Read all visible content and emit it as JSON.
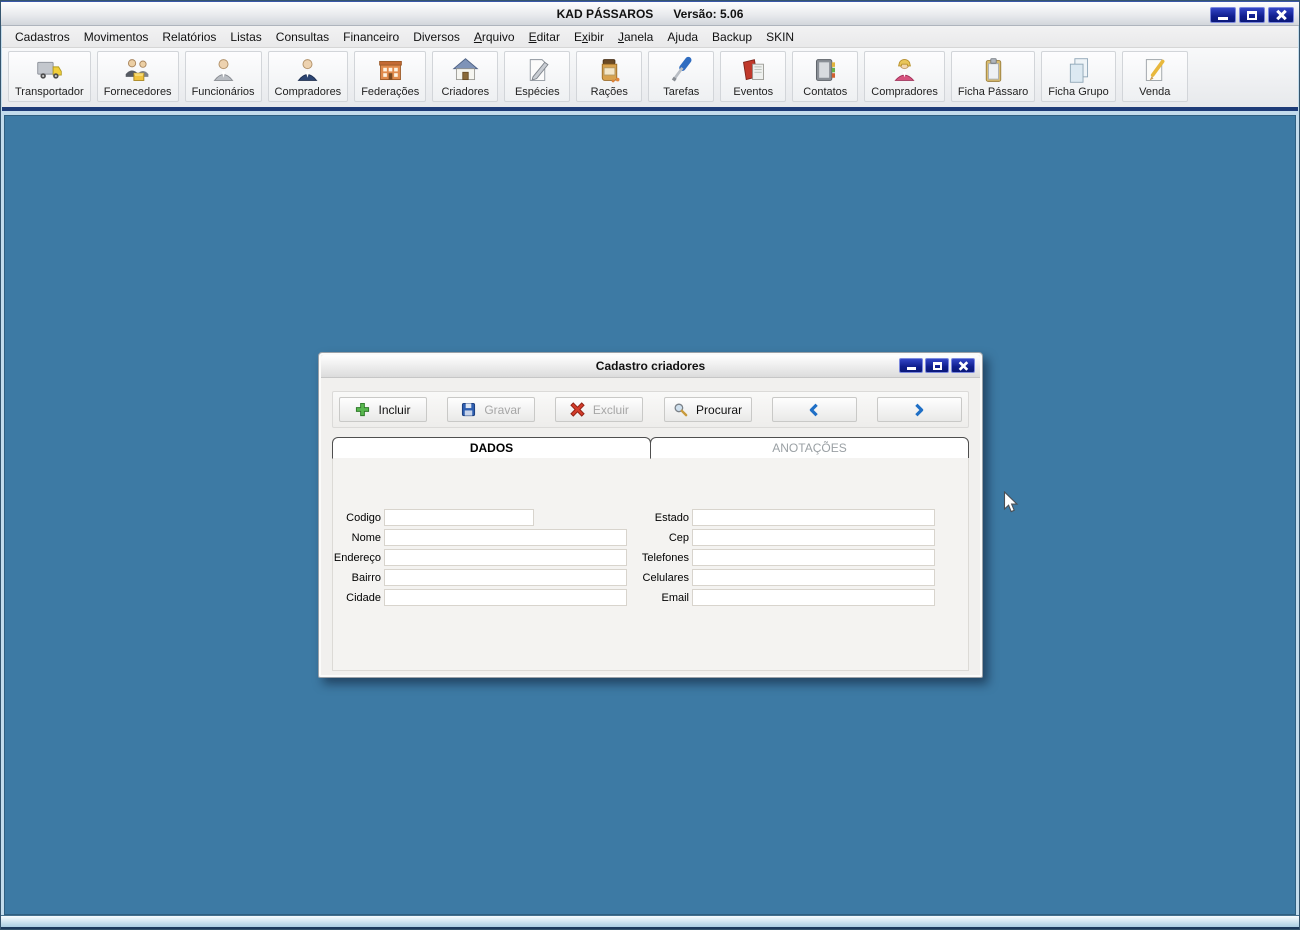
{
  "window": {
    "title": "KAD PÁSSAROS",
    "version_label": "Versão: 5.06"
  },
  "menubar": {
    "items": [
      {
        "label": "Cadastros",
        "underline": -1
      },
      {
        "label": "Movimentos",
        "underline": -1
      },
      {
        "label": "Relatórios",
        "underline": -1
      },
      {
        "label": "Listas",
        "underline": -1
      },
      {
        "label": "Consultas",
        "underline": -1
      },
      {
        "label": "Financeiro",
        "underline": -1
      },
      {
        "label": "Diversos",
        "underline": -1
      },
      {
        "label": "Arquivo",
        "underline": 0
      },
      {
        "label": "Editar",
        "underline": 0
      },
      {
        "label": "Exibir",
        "underline": 1
      },
      {
        "label": "Janela",
        "underline": 0
      },
      {
        "label": "Ajuda",
        "underline": -1
      },
      {
        "label": "Backup",
        "underline": -1
      },
      {
        "label": "SKIN",
        "underline": -1
      }
    ]
  },
  "toolbar": {
    "items": [
      {
        "label": "Transportador",
        "icon": "truck-icon"
      },
      {
        "label": "Fornecedores",
        "icon": "suppliers-icon"
      },
      {
        "label": "Funcionários",
        "icon": "employee-icon"
      },
      {
        "label": "Compradores",
        "icon": "buyer-icon"
      },
      {
        "label": "Federações",
        "icon": "federation-building-icon"
      },
      {
        "label": "Criadores",
        "icon": "house-icon"
      },
      {
        "label": "Espécies",
        "icon": "paper-pencil-icon"
      },
      {
        "label": "Rações",
        "icon": "feed-jar-icon"
      },
      {
        "label": "Tarefas",
        "icon": "screwdriver-icon"
      },
      {
        "label": "Eventos",
        "icon": "red-book-icon"
      },
      {
        "label": "Contatos",
        "icon": "address-book-icon"
      },
      {
        "label": "Compradores",
        "icon": "buyer-woman-icon"
      },
      {
        "label": "Ficha Pássaro",
        "icon": "clipboard-icon"
      },
      {
        "label": "Ficha Grupo",
        "icon": "pages-icon"
      },
      {
        "label": "Venda",
        "icon": "sale-note-icon"
      }
    ]
  },
  "dialog": {
    "title": "Cadastro criadores",
    "actions": [
      {
        "label": "Incluir",
        "icon": "plus-icon",
        "enabled": true,
        "name": "include-button"
      },
      {
        "label": "Gravar",
        "icon": "save-icon",
        "enabled": false,
        "name": "save-button"
      },
      {
        "label": "Excluir",
        "icon": "delete-icon",
        "enabled": false,
        "name": "delete-button"
      },
      {
        "label": "Procurar",
        "icon": "search-icon",
        "enabled": true,
        "name": "search-button"
      },
      {
        "label": "",
        "icon": "chevron-left-icon",
        "enabled": true,
        "name": "previous-record-button"
      },
      {
        "label": "",
        "icon": "chevron-right-icon",
        "enabled": true,
        "name": "next-record-button"
      }
    ],
    "tabs": [
      {
        "label": "DADOS",
        "active": true
      },
      {
        "label": "ANOTAÇÕES",
        "active": false
      }
    ],
    "form": {
      "columns": [
        {
          "fields": [
            {
              "label": "Codigo",
              "value": "",
              "size": "small"
            },
            {
              "label": "Nome",
              "value": ""
            },
            {
              "label": "Endereço",
              "value": ""
            },
            {
              "label": "Bairro",
              "value": ""
            },
            {
              "label": "Cidade",
              "value": ""
            }
          ]
        },
        {
          "fields": [
            {
              "label": "Estado",
              "value": ""
            },
            {
              "label": "Cep",
              "value": ""
            },
            {
              "label": "Telefones",
              "value": ""
            },
            {
              "label": "Celulares",
              "value": ""
            },
            {
              "label": "Email",
              "value": ""
            }
          ]
        }
      ]
    }
  },
  "colors": {
    "client_background": "#3d7aa4",
    "titlebar_accent": "#101f8e",
    "toolbar_divider": "#1e3c78",
    "chevron_blue": "#1f6fc6",
    "plus_green": "#58b84e",
    "delete_red": "#d23c2a",
    "save_blue": "#2f5fb0"
  }
}
